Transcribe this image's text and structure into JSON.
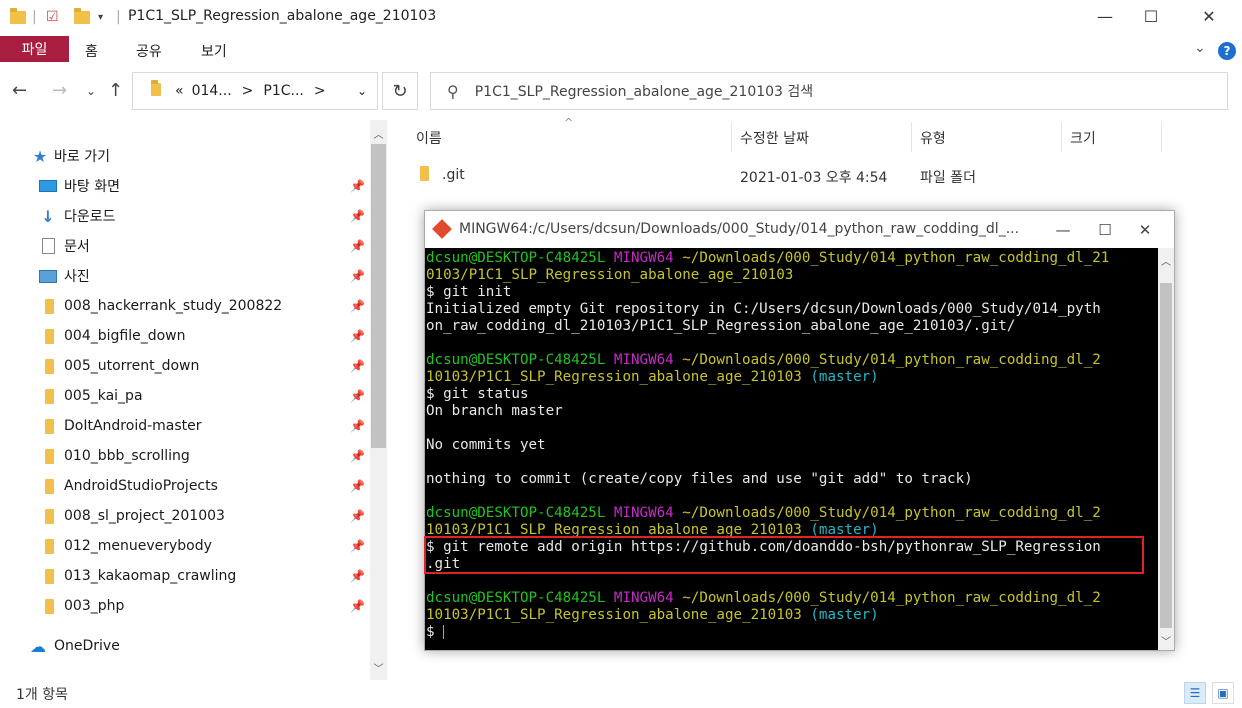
{
  "window": {
    "title": "P1C1_SLP_Regression_abalone_age_210103",
    "minimize_icon": "minimize-icon",
    "maximize_icon": "maximize-icon",
    "close_icon": "close-icon"
  },
  "ribbon": {
    "tabs": [
      "파일",
      "홈",
      "공유",
      "보기"
    ],
    "help_label": "?"
  },
  "nav": {
    "address_segments": [
      "«",
      "014...",
      ">",
      "P1C...",
      ">"
    ],
    "search_placeholder": "P1C1_SLP_Regression_abalone_age_210103 검색"
  },
  "sidebar": {
    "quick_access": "바로 가기",
    "items": [
      {
        "label": "바탕 화면",
        "icon": "desktop-icon"
      },
      {
        "label": "다운로드",
        "icon": "download-icon"
      },
      {
        "label": "문서",
        "icon": "document-icon"
      },
      {
        "label": "사진",
        "icon": "pictures-icon"
      },
      {
        "label": "008_hackerrank_study_200822",
        "icon": "folder-icon"
      },
      {
        "label": "004_bigfile_down",
        "icon": "folder-icon"
      },
      {
        "label": "005_utorrent_down",
        "icon": "folder-icon"
      },
      {
        "label": "005_kai_pa",
        "icon": "folder-icon"
      },
      {
        "label": "DoItAndroid-master",
        "icon": "folder-icon"
      },
      {
        "label": "010_bbb_scrolling",
        "icon": "folder-icon"
      },
      {
        "label": "AndroidStudioProjects",
        "icon": "folder-icon"
      },
      {
        "label": "008_sl_project_201003",
        "icon": "folder-icon"
      },
      {
        "label": "012_menueverybody",
        "icon": "folder-icon"
      },
      {
        "label": "013_kakaomap_crawling",
        "icon": "folder-icon"
      },
      {
        "label": "003_php",
        "icon": "folder-icon"
      }
    ],
    "onedrive": "OneDrive"
  },
  "list": {
    "columns": [
      "이름",
      "수정한 날짜",
      "유형",
      "크기"
    ],
    "rows": [
      {
        "name": ".git",
        "modified": "2021-01-03 오후 4:54",
        "type": "파일 폴더",
        "size": ""
      }
    ]
  },
  "status": {
    "item_count": "1개 항목"
  },
  "terminal": {
    "title": "MINGW64:/c/Users/dcsun/Downloads/000_Study/014_python_raw_codding_dl_...",
    "user": "dcsun@DESKTOP-C48425L",
    "shell": "MINGW64",
    "path1a": "~/Downloads/000_Study/014_python_raw_codding_dl_21",
    "path1b": "0103/P1C1_SLP_Regression_abalone_age_210103",
    "cmd1": "$ git init",
    "out1a": "Initialized empty Git repository in C:/Users/dcsun/Downloads/000_Study/014_pyth",
    "out1b": "on_raw_codding_dl_210103/P1C1_SLP_Regression_abalone_age_210103/.git/",
    "path2a": "~/Downloads/000_Study/014_python_raw_codding_dl_2",
    "path2b": "10103/P1C1_SLP_Regression_abalone_age_210103",
    "branch": "(master)",
    "cmd2": "$ git status",
    "out2a": "On branch master",
    "out2b": "No commits yet",
    "out2c": "nothing to commit (create/copy files and use \"git add\" to track)",
    "cmd3a": "$ git remote add origin https://github.com/doanddo-bsh/pythonraw_SLP_Regression",
    "cmd3b": ".git",
    "prompt": "$ "
  }
}
